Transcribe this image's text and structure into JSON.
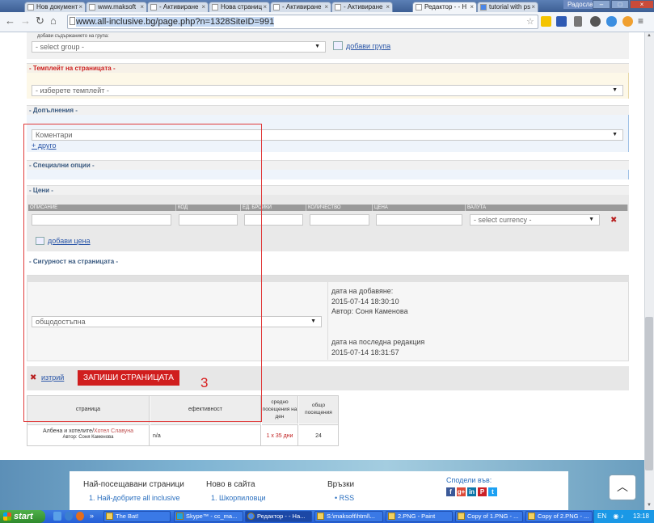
{
  "browser": {
    "tabs": [
      {
        "label": "Нов документ",
        "active": false
      },
      {
        "label": "www.maksoft",
        "active": false
      },
      {
        "label": "- Активиране",
        "active": false
      },
      {
        "label": "Нова страниц",
        "active": false
      },
      {
        "label": "- Активиране",
        "active": false
      },
      {
        "label": "- Активиране",
        "active": false
      },
      {
        "label": "Редактор - - Н",
        "active": true
      },
      {
        "label": "tutorial with ps",
        "active": false
      }
    ],
    "user": "Радослав",
    "url": "www.all-inclusive.bg/page.php?n=1328SiteID=991"
  },
  "group": {
    "hint": "добави съдържанието на група:",
    "select_value": "- select group -",
    "add_label": "добави група"
  },
  "template": {
    "header": "- Темплейт на страницата -",
    "select_value": "- изберете темплейт -"
  },
  "extras": {
    "header": "- Допълнения -",
    "select_value": "Коментари",
    "add_more": "+ друго"
  },
  "special": {
    "header": "- Специални опции -"
  },
  "prices": {
    "header": "- Цени -",
    "columns": [
      "ОПИСАНИЕ",
      "КОД",
      "ЕД. БРОЙКИ",
      "КОЛИЧЕСТВО",
      "ЦЕНА",
      "ВАЛУТА"
    ],
    "currency_select": "- select currency -",
    "add_label": "добави цена"
  },
  "security": {
    "header": "- Сигурност на страницата -",
    "select_value": "общодостъпна",
    "added_label": "дата на добавяне:",
    "added_date": "2015-07-14 18:30:10",
    "author": "Автор: Соня Каменова",
    "edited_label": "дата на последна редакция",
    "edited_date": "2015-07-14 18:31:57"
  },
  "actions": {
    "delete_label": "изтрий",
    "save_label": "ЗАПИШИ СТРАНИЦАТА"
  },
  "annotation": {
    "number": "3",
    "color": "#e03a3a"
  },
  "stats": {
    "headers": [
      "страница",
      "ефективност",
      "средно посещения на ден",
      "общо посещения"
    ],
    "row": {
      "page_prefix": "Албена и хотелите/",
      "page_link": "Хотел Славуна",
      "page_author": "Автор: Соня Каменова",
      "efficiency": "n/a",
      "daily": "1 x 35 дни",
      "total": "24"
    }
  },
  "footer": {
    "col1_title": "Най-посещавани страници",
    "col1_item": "1.  Най-добрите all inclusive",
    "col2_title": "Ново в сайта",
    "col2_item": "1.  Шкорпиловци",
    "col3_title": "Връзки",
    "col3_item": "•  RSS",
    "share_title": "Сподели във:",
    "share_icons": [
      "f",
      "g+",
      "in",
      "P",
      "t"
    ]
  },
  "taskbar": {
    "start_label": "start",
    "tasks": [
      {
        "label": "The Bat!",
        "active": false
      },
      {
        "label": "Skype™ - cc_ma...",
        "active": false
      },
      {
        "label": "Редактор - - На...",
        "active": true
      },
      {
        "label": "S:\\maksoft\\html\\...",
        "active": false
      },
      {
        "label": "2.PNG - Paint",
        "active": false
      },
      {
        "label": "Copy of 1.PNG - ...",
        "active": false
      },
      {
        "label": "Copy of 2.PNG - ...",
        "active": false
      }
    ],
    "lang": "EN",
    "clock": "13:18"
  }
}
